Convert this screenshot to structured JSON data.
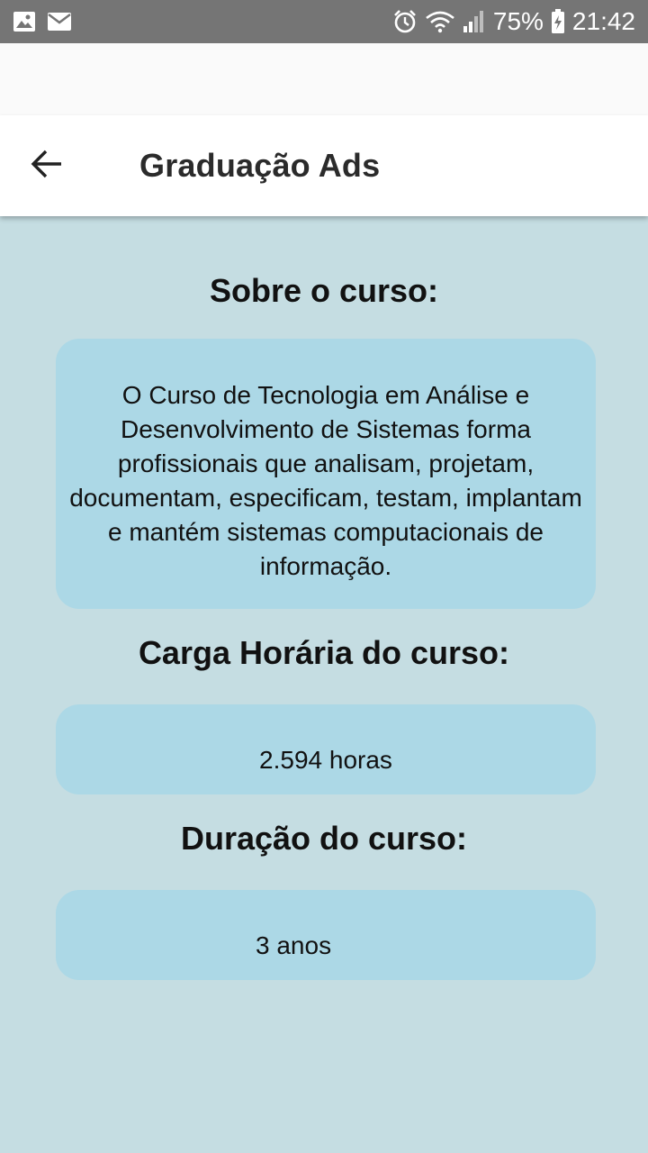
{
  "status_bar": {
    "battery_percent": "75%",
    "time": "21:42",
    "icons": [
      "image-icon",
      "mail-icon",
      "alarm-icon",
      "wifi-icon",
      "signal-icon",
      "battery-charging-icon"
    ]
  },
  "app_bar": {
    "title": "Graduação Ads",
    "back_icon": "arrow-left-icon"
  },
  "sections": {
    "about": {
      "title": "Sobre o curso:",
      "text": "O Curso de Tecnologia em Análise e Desenvolvimento de Sistemas forma profissionais que  analisam, projetam, documentam, especificam, testam, implantam e mantém sistemas computacionais de informação."
    },
    "workload": {
      "title": "Carga Horária do curso:",
      "value": "2.594 horas"
    },
    "duration": {
      "title": "Duração do curso:",
      "value": "3 anos"
    }
  },
  "colors": {
    "background": "#c5dde2",
    "card": "#acd8e6",
    "status_bar": "#757575",
    "app_bar": "#ffffff"
  }
}
